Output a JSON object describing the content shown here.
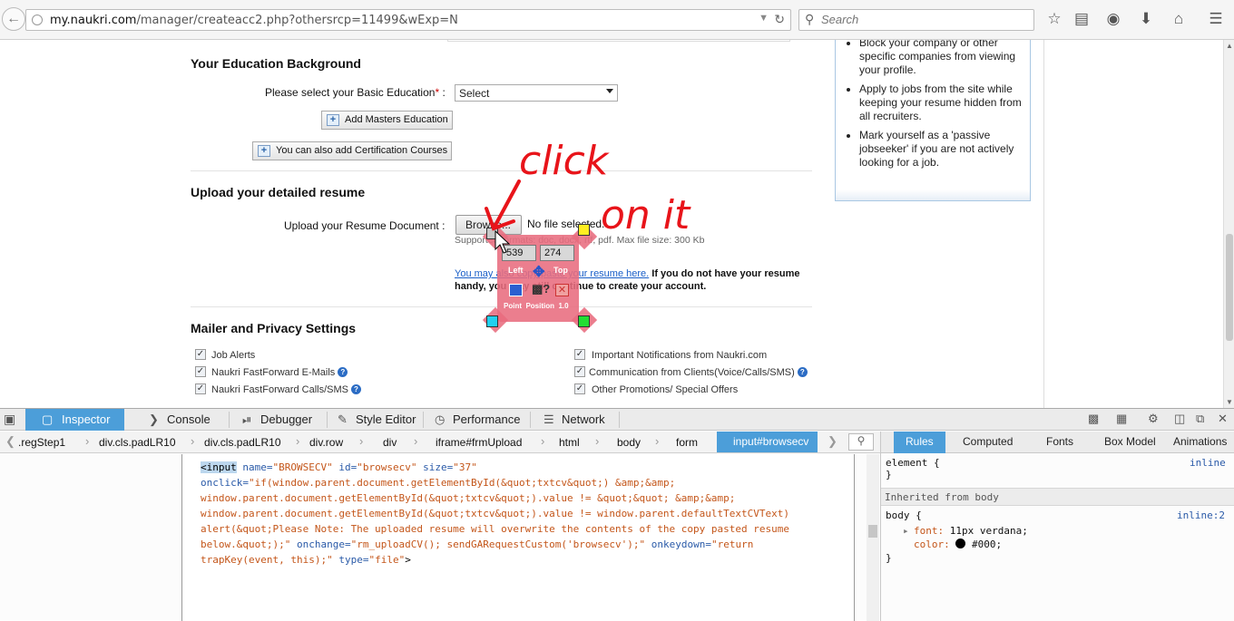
{
  "browser": {
    "url_host": "my.naukri.com",
    "url_path": "/manager/createacc2.php?othersrcp=11499&wExp=N",
    "search_placeholder": "Search"
  },
  "sidebar": {
    "items": [
      "Block your company or other specific companies from viewing your profile.",
      "Apply to jobs from the site while keeping your resume hidden from all recruiters.",
      "Mark yourself as a 'passive jobseeker' if you are not actively looking for a job."
    ]
  },
  "education": {
    "title": "Your Education Background",
    "basic_label": "Please select your Basic Education",
    "required_mark": "*",
    "colon": ":",
    "basic_value": "Select",
    "add_masters": "Add Masters Education",
    "add_cert": "You can also add Certification Courses"
  },
  "resume": {
    "title": "Upload your detailed resume",
    "label": "Upload your Resume Document :",
    "browse": "Browse...",
    "no_file": "No file selected.",
    "supported": "Supported formats: doc, docx, rtf, pdf. Max file size: 300 Kb",
    "paste_link": "You may also copy paste your resume here.",
    "note_bold": "If you do not have your resume handy, you may still continue to create your account."
  },
  "mailer": {
    "title": "Mailer and Privacy Settings",
    "left": [
      "Job Alerts",
      "Naukri FastForward E-Mails",
      "Naukri FastForward Calls/SMS"
    ],
    "right": [
      "Important Notifications from Naukri.com",
      "Communication from Clients(Voice/Calls/SMS)",
      "Other Promotions/ Special Offers"
    ]
  },
  "annotation": {
    "line1": "click",
    "line2": "on it",
    "color": "#e8141a"
  },
  "point_position": {
    "left_value": "539",
    "top_value": "274",
    "left_label": "Left",
    "top_label": "Top",
    "footer": "Point  Position  1.0"
  },
  "devtools": {
    "tabs": [
      "Inspector",
      "Console",
      "Debugger",
      "Style Editor",
      "Performance",
      "Network"
    ],
    "breadcrumbs": [
      ".regStep1",
      "div.cls.padLR10",
      "div.cls.padLR10",
      "div.row",
      "div",
      "iframe#frmUpload",
      "html",
      "body",
      "form",
      "input#browsecv"
    ],
    "code": [
      {
        "k": "tgsel",
        "t": "<input"
      },
      {
        "k": "an",
        "t": " name="
      },
      {
        "k": "av",
        "t": "\"BROWSECV\""
      },
      {
        "k": "an",
        "t": " id="
      },
      {
        "k": "av",
        "t": "\"browsecv\""
      },
      {
        "k": "an",
        "t": " size="
      },
      {
        "k": "av",
        "t": "\"37\""
      },
      {
        "k": "an",
        "t": " onclick="
      },
      {
        "k": "av",
        "t": "\"if(window.parent.document.getElementById(&quot;txtcv&quot;) &amp;&amp; window.parent.document.getElementById(&quot;txtcv&quot;).value != &quot;&quot; &amp;&amp; window.parent.document.getElementById(&quot;txtcv&quot;).value != window.parent.defaultTextCVText) alert(&quot;Please Note: The uploaded resume will overwrite the contents of the copy pasted resume below.&quot;);\""
      },
      {
        "k": "an",
        "t": " onchange="
      },
      {
        "k": "av",
        "t": "\"rm_uploadCV(); sendGARequestCustom('browsecv');\""
      },
      {
        "k": "an",
        "t": " onkeydown="
      },
      {
        "k": "av",
        "t": "\"return trapKey(event, this);\""
      },
      {
        "k": "an",
        "t": " type="
      },
      {
        "k": "av",
        "t": "\"file\""
      },
      {
        "k": "tg",
        "t": ">"
      }
    ],
    "rules_tabs": [
      "Rules",
      "Computed",
      "Fonts",
      "Box Model",
      "Animations"
    ],
    "rules": {
      "element_selector": "element {",
      "element_close": "}",
      "element_source": "inline",
      "inherited": "Inherited from body",
      "body_selector": "body {",
      "body_source": "inline:2",
      "font_prop": "font:",
      "font_val": "11px verdana;",
      "color_prop": "color:",
      "color_val": "#000;",
      "body_close": "}"
    }
  }
}
